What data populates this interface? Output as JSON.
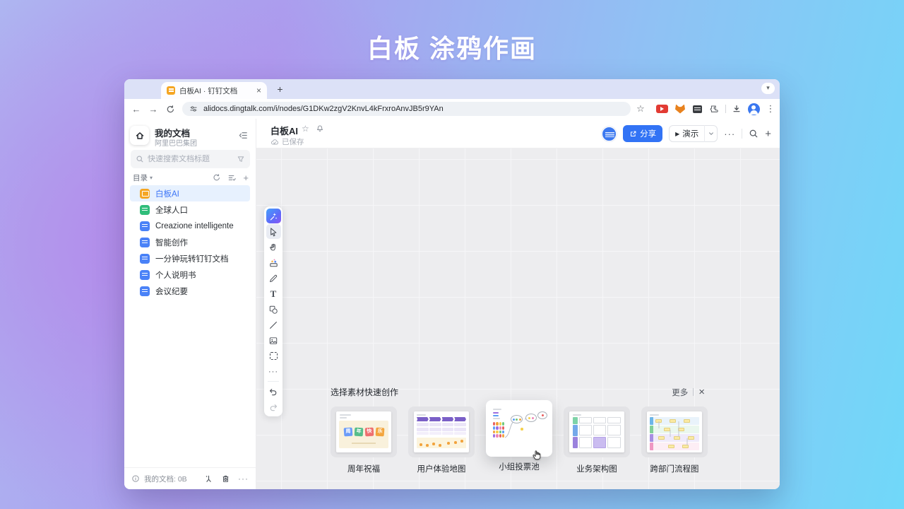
{
  "page_title": "白板 涂鸦作画",
  "browser": {
    "tab_title": "白板AI · 钉钉文档",
    "url": "alidocs.dingtalk.com/i/nodes/G1DKw2zgV2KnvL4kFrxroAnvJB5r9YAn"
  },
  "sidebar": {
    "workspace_title": "我的文档",
    "workspace_subtitle": "阿里巴巴集团",
    "search_placeholder": "快速搜索文档标题",
    "section_label": "目录",
    "items": [
      {
        "label": "白板AI",
        "icon_color": "#f5a623",
        "type": "board",
        "selected": true
      },
      {
        "label": "全球人口",
        "icon_color": "#30bd7a",
        "type": "sheet",
        "selected": false
      },
      {
        "label": "Creazione intelligente",
        "icon_color": "#4a82f7",
        "type": "doc",
        "selected": false
      },
      {
        "label": "智能创作",
        "icon_color": "#4a82f7",
        "type": "doc",
        "selected": false
      },
      {
        "label": "一分钟玩转钉钉文档",
        "icon_color": "#4a82f7",
        "type": "doc",
        "selected": false
      },
      {
        "label": "个人说明书",
        "icon_color": "#4a82f7",
        "type": "doc",
        "selected": false
      },
      {
        "label": "会议纪要",
        "icon_color": "#4a82f7",
        "type": "doc",
        "selected": false
      }
    ],
    "footer_storage": "我的文档: 0B"
  },
  "doc_header": {
    "title": "白板AI",
    "save_status": "已保存",
    "share_label": "分享",
    "present_label": "演示"
  },
  "toolbar_tools": [
    "ai-assistant",
    "select",
    "hand",
    "sticker-material",
    "pen",
    "text",
    "shape",
    "line",
    "image",
    "marquee-select",
    "more",
    "undo",
    "redo"
  ],
  "tray": {
    "title": "选择素材快速创作",
    "more_label": "更多",
    "cards": [
      {
        "label": "周年祝福",
        "hovered": false
      },
      {
        "label": "用户体验地图",
        "hovered": false
      },
      {
        "label": "小组投票池",
        "hovered": true
      },
      {
        "label": "业务架构图",
        "hovered": false
      },
      {
        "label": "跨部门流程图",
        "hovered": false
      }
    ],
    "anniversary_text": [
      "周",
      "年",
      "快",
      "乐"
    ]
  },
  "colors": {
    "accent_blue": "#3273f5",
    "selected_doc_bg": "#e7f1fe",
    "selected_doc_text": "#3b74f6",
    "canvas_bg": "#ededef",
    "gradient_purple": "#b584e9",
    "gradient_cyan": "#70d8f9",
    "ai_gradient_start": "#45a0fb",
    "ai_gradient_end": "#8a57f5"
  }
}
